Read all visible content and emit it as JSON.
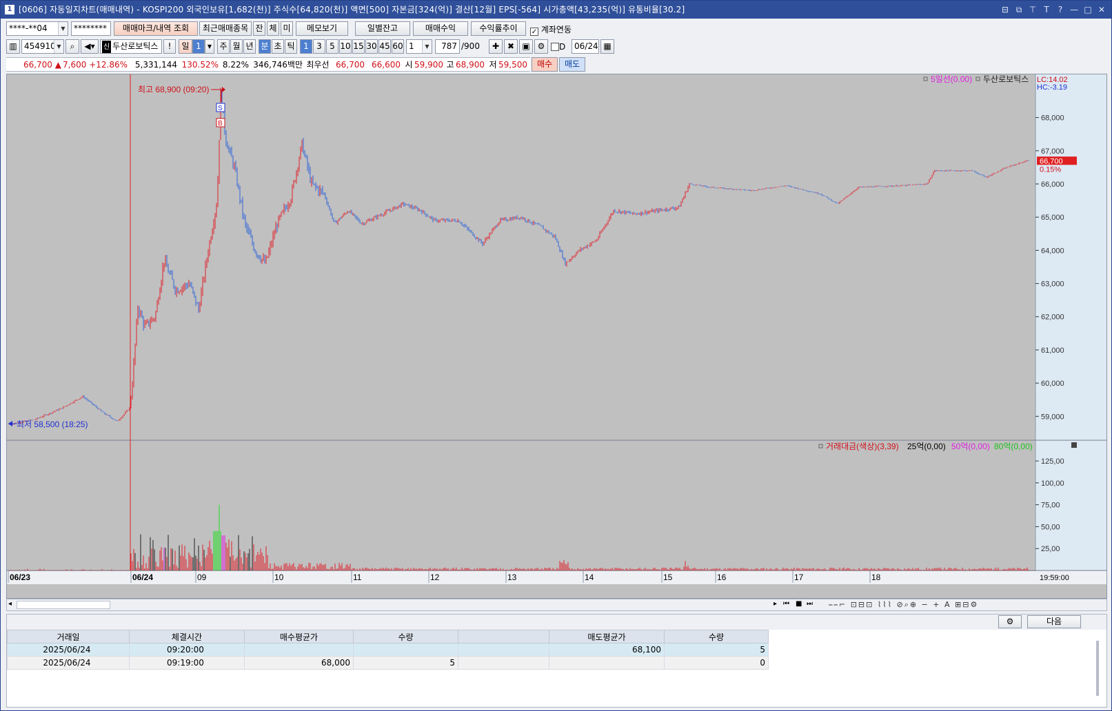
{
  "window": {
    "title": "[0606] 자동일지차트(매매내역) - KOSPI200 외국인보유[1,682(천)] 주식수[64,820(천)] 액면[500] 자본금[324(억)] 결산[12월] EPS[-564] 시가총액[43,235(억)] 유통비율[30.2]",
    "app_icon": "1",
    "title_buttons": [
      "⊟",
      "⧉",
      "⊤",
      "T",
      "?",
      "—",
      "□",
      "✕"
    ]
  },
  "toolbar1": {
    "account": "****-**04",
    "password": "********",
    "btn_trade_mark": "매매마크/내역 조회",
    "btn_recent": "최근매매종목",
    "btn_jan": "잔",
    "btn_che": "체",
    "btn_mi": "미",
    "btn_memo": "메모보기",
    "btn_daily": "일별잔고",
    "btn_profit": "매매수익",
    "btn_return": "수익률추이",
    "chk_account_link": "계좌연동",
    "chk_mark": "✓"
  },
  "toolbar2": {
    "code": "454910",
    "name": "두산로보틱스",
    "name_badge": "신",
    "btn_excl": "!",
    "period_day": "일",
    "period_day_val": "1",
    "period_week": "주",
    "period_month": "월",
    "period_year": "년",
    "period_min": "분",
    "period_sec": "초",
    "period_tick": "틱",
    "intervals": [
      "1",
      "3",
      "5",
      "10",
      "15",
      "30",
      "45",
      "60"
    ],
    "interval_sel": "1",
    "count": "787",
    "count_max": "/900",
    "chk_d": "D",
    "date": "06/24"
  },
  "quote": {
    "price": "66,700",
    "arrow": "▲",
    "change": "7,600",
    "change_pct": "+12.86%",
    "volume": "5,331,144",
    "vol_ratio": "130.52%",
    "turnover": "8.22%",
    "amount": "346,746백만",
    "best_label": "최우선",
    "ask": "66,700",
    "bid": "66,600",
    "open_label": "시",
    "open": "59,900",
    "high_label": "고",
    "high": "68,900",
    "low_label": "저",
    "low": "59,500",
    "btn_buy": "매수",
    "btn_sell": "매도"
  },
  "chart": {
    "high_label": "최고 68,900 (09:20)",
    "low_label": "최저 58,500 (18:25)",
    "legend_ma": "5일선(0.00)",
    "legend_name": "두산로보틱스",
    "lc": "LC:14.02",
    "hc": "HC:-3.19",
    "current_price": "66,700",
    "current_pct": "0.15%",
    "marker_s": "S",
    "marker_b": "B",
    "vol_legend_main": "거래대금(색상)(3,39)",
    "vol_legend_25": "25억(0,00)",
    "vol_legend_50": "50억(0,00)",
    "vol_legend_80": "80억(0,00)",
    "time_label": "19:59:00",
    "price_ticks": [
      "68,000",
      "67,000",
      "66,000",
      "65,000",
      "64,000",
      "63,000",
      "62,000",
      "61,000",
      "60,000",
      "59,000"
    ],
    "vol_ticks": [
      "125,00",
      "100,00",
      "75,00",
      "50,00",
      "25,00"
    ],
    "x_ticks": [
      "06/23",
      "06/24",
      "09",
      "10",
      "11",
      "12",
      "13",
      "14",
      "15",
      "16",
      "17",
      "18"
    ],
    "colors": {
      "up": "#e0202a",
      "down": "#2f63d8",
      "bg": "#c0c0c0",
      "vol_black": "#202020",
      "vol_magenta": "#e020e0",
      "vol_green": "#20e020"
    }
  },
  "bottom": {
    "btn_next": "다음",
    "headers": [
      "거래일",
      "체결시간",
      "매수평균가",
      "수량",
      "",
      "매도평균가",
      "수량"
    ],
    "rows": [
      [
        "2025/06/24",
        "09:20:00",
        "",
        "",
        "",
        "68,100",
        "5"
      ],
      [
        "2025/06/24",
        "09:19:00",
        "68,000",
        "5",
        "",
        "",
        "0"
      ]
    ]
  }
}
